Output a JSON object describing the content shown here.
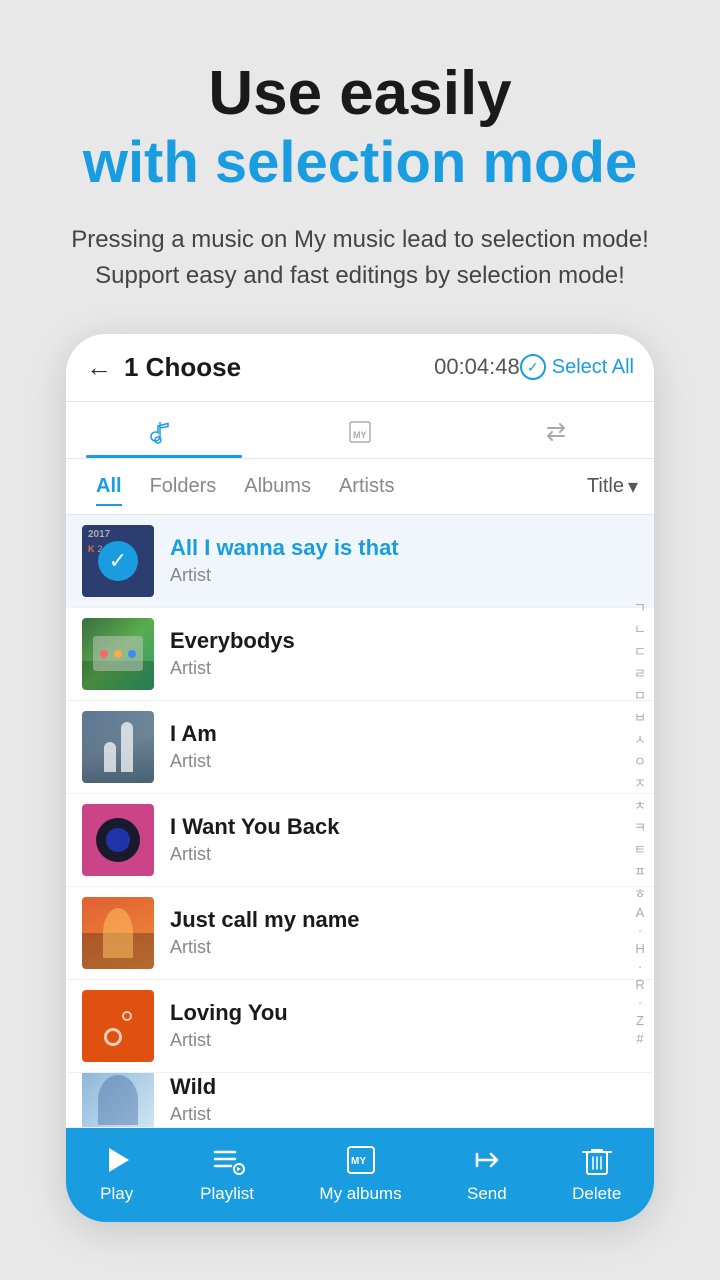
{
  "header_title": "Use easily",
  "header_subtitle": "with selection mode",
  "description_line1": "Pressing a music on My music lead to selection mode!",
  "description_line2": "Support easy and fast editings by selection mode!",
  "app": {
    "nav_title": "1 Choose",
    "nav_time": "00:04:48",
    "select_all_label": "Select All",
    "tabs_icons": [
      "music-note",
      "my-music",
      "arrows"
    ],
    "filter_tabs": [
      "All",
      "Folders",
      "Albums",
      "Artists"
    ],
    "active_filter": "All",
    "sort_label": "Title",
    "songs": [
      {
        "title": "All I wanna say is that",
        "artist": "Artist",
        "thumb_color": "dark-blue",
        "selected": true,
        "year": "2017"
      },
      {
        "title": "Everybodys",
        "artist": "Artist",
        "thumb_color": "green",
        "selected": false
      },
      {
        "title": "I Am",
        "artist": "Artist",
        "thumb_color": "warm",
        "selected": false
      },
      {
        "title": "I Want You Back",
        "artist": "Artist",
        "thumb_color": "pink",
        "selected": false
      },
      {
        "title": "Just call my name",
        "artist": "Artist",
        "thumb_color": "sunset",
        "selected": false
      },
      {
        "title": "Loving You",
        "artist": "Artist",
        "thumb_color": "orange",
        "selected": false
      },
      {
        "title": "Wild",
        "artist": "Artist",
        "thumb_color": "blue-illus",
        "selected": false
      }
    ],
    "alphabet": [
      "ㄱ",
      "ㄴ",
      "ㄷ",
      "ㄹ",
      "ㅁ",
      "ㅂ",
      "ㅅ",
      "ㅇ",
      "ㅈ",
      "ㅊ",
      "ㅋ",
      "ㅌ",
      "ㅍ",
      "ㅎ",
      "A",
      "·",
      "H",
      "·",
      "R",
      "·",
      "Z",
      "#"
    ],
    "action_bar": {
      "play_label": "Play",
      "playlist_label": "Playlist",
      "my_albums_label": "My albums",
      "send_label": "Send",
      "delete_label": "Delete"
    }
  }
}
